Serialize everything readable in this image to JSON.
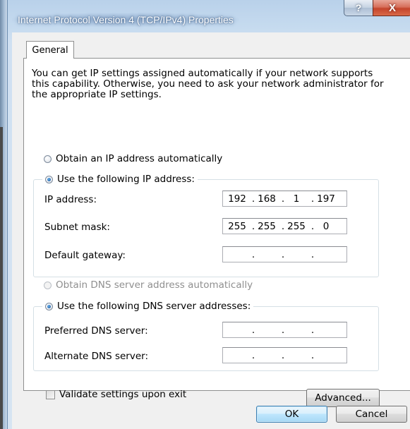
{
  "window": {
    "title": "Internet Protocol Version 4 (TCP/IPv4) Properties",
    "help_label": "?",
    "close_label": "X"
  },
  "tabs": [
    {
      "label": "General",
      "selected": true
    }
  ],
  "intro_text": "You can get IP settings assigned automatically if your network supports this capability. Otherwise, you need to ask your network administrator for the appropriate IP settings.",
  "ip_mode": {
    "auto_label": "Obtain an IP address automatically",
    "auto_checked": false,
    "manual_label": "Use the following IP address:",
    "manual_checked": true
  },
  "ip_fields": {
    "ip_address": {
      "label": "IP address:",
      "octets": [
        "192",
        "168",
        "1",
        "197"
      ]
    },
    "subnet_mask": {
      "label": "Subnet mask:",
      "octets": [
        "255",
        "255",
        "255",
        "0"
      ]
    },
    "default_gateway": {
      "label": "Default gateway:",
      "octets": [
        "",
        "",
        "",
        ""
      ]
    }
  },
  "dns_mode": {
    "auto_label": "Obtain DNS server address automatically",
    "auto_checked": false,
    "auto_disabled": true,
    "manual_label": "Use the following DNS server addresses:",
    "manual_checked": true
  },
  "dns_fields": {
    "preferred": {
      "label": "Preferred DNS server:",
      "octets": [
        "",
        "",
        "",
        ""
      ]
    },
    "alternate": {
      "label": "Alternate DNS server:",
      "octets": [
        "",
        "",
        "",
        ""
      ]
    }
  },
  "validate": {
    "label": "Validate settings upon exit",
    "checked": false
  },
  "buttons": {
    "advanced": "Advanced...",
    "ok": "OK",
    "cancel": "Cancel"
  },
  "ip_separator": "."
}
